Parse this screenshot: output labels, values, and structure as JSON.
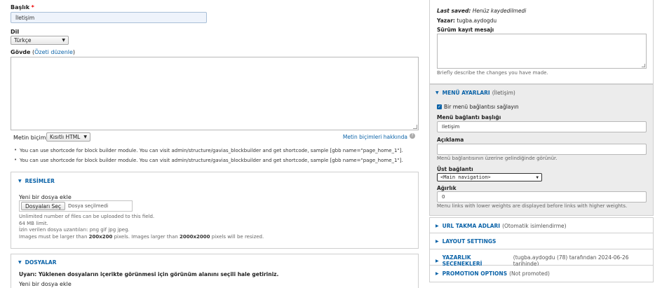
{
  "title_field": {
    "label": "Başlık",
    "required_mark": "*",
    "value": "İletişim"
  },
  "language": {
    "label": "Dil",
    "selected": "Türkçe"
  },
  "body": {
    "label": "Gövde",
    "summary_link": "Özeti düzenle",
    "paren_open": "(",
    "paren_close": ")"
  },
  "text_format": {
    "label": "Metin biçimi",
    "selected": "Kısıtlı HTML",
    "help_link": "Metin biçimleri hakkında",
    "tips": [
      "You can use shortcode for block builder module. You can visit admin/structure/gavias_blockbuilder and get shortcode, sample [gbb name=\"page_home_1\"].",
      "You can use shortcode for block builder module. You can visit admin/structure/gavias_blockbuilder and get shortcode, sample [gbb name=\"page_home_1\"]."
    ]
  },
  "images": {
    "title": "RESİMLER",
    "add_label": "Yeni bir dosya ekle",
    "choose_button": "Dosyaları Seç",
    "no_file": "Dosya seçilmedi",
    "limit_1": "Unlimited number of files can be uploaded to this field.",
    "limit_2": "64 MB limit.",
    "extensions": "İzin verilen dosya uzantıları: png gif jpg jpeg.",
    "size_prefix": "Images must be larger than ",
    "size_min": "200x200",
    "size_mid": " pixels. Images larger than ",
    "size_max": "2000x2000",
    "size_suffix": " pixels will be resized."
  },
  "files": {
    "title": "DOSYALAR",
    "warning": "Uyarı: Yüklenen dosyaların içerikte görünmesi için görünüm alanını seçili hale getiriniz.",
    "add_label": "Yeni bir dosya ekle"
  },
  "meta": {
    "last_saved_label": "Last saved:",
    "last_saved_value": "Henüz kaydedilmedi",
    "author_label": "Yazar:",
    "author_value": "tugba.aydogdu",
    "revision_label": "Sürüm kayıt mesajı",
    "revision_desc": "Briefly describe the changes you have made."
  },
  "menu": {
    "title": "MENÜ AYARLARI",
    "subtitle": "(İletişim)",
    "provide_link_label": "Bir menü bağlantısı sağlayın",
    "provide_link_checked": true,
    "link_title_label": "Menü bağlantı başlığı",
    "link_title_value": "İletişim",
    "description_label": "Açıklama",
    "description_desc": "Menü bağlantısının üzerine gelindiğinde görünür.",
    "parent_label": "Üst bağlantı",
    "parent_selected": "<Main navigation>",
    "weight_label": "Ağırlık",
    "weight_value": "0",
    "weight_desc": "Menu links with lower weights are displayed before links with higher weights."
  },
  "sections": [
    {
      "title": "URL TAKMA ADLARI",
      "subtitle": "(Otomatik isimlendirme)"
    },
    {
      "title": "LAYOUT SETTINGS",
      "subtitle": ""
    },
    {
      "title": "YAZARLIK SEÇENEKLERİ",
      "subtitle": "(tugba.aydogdu (78) tarafından 2024-06-26 tarihinde)"
    },
    {
      "title": "PROMOTION OPTIONS",
      "subtitle": "(Not promoted)"
    }
  ],
  "colors": {
    "link": "#0b63a8",
    "required": "#e00000",
    "field_focus_bg": "#eef3fb",
    "panel_bg": "#ececec"
  }
}
